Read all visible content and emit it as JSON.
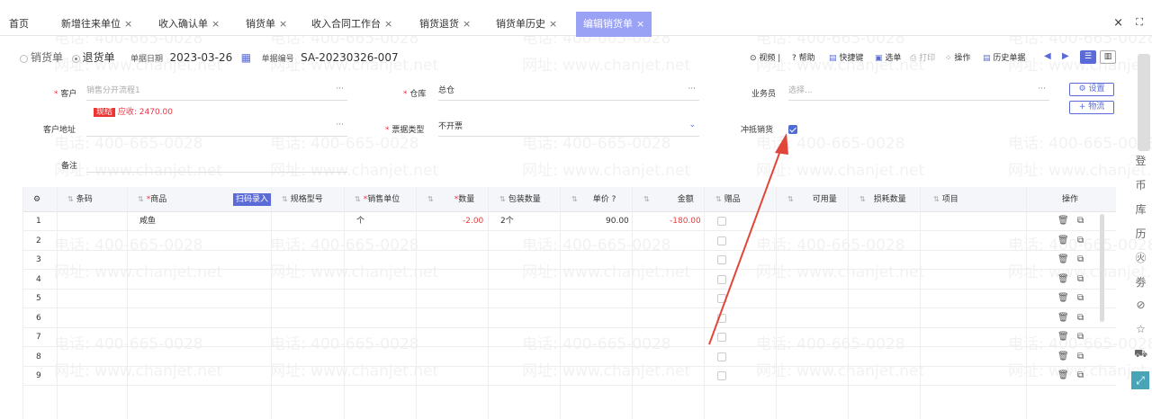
{
  "tabs": [
    {
      "label": "首页",
      "closable": false
    },
    {
      "label": "新增往来单位",
      "closable": true
    },
    {
      "label": "收入确认单",
      "closable": true
    },
    {
      "label": "销货单",
      "closable": true
    },
    {
      "label": "收入合同工作台",
      "closable": true
    },
    {
      "label": "销货退货",
      "closable": true
    },
    {
      "label": "销货单历史",
      "closable": true
    },
    {
      "label": "编辑销货单",
      "closable": true,
      "active": true
    }
  ],
  "tab_close": "×",
  "toolbar": {
    "doc_type_sale": "销货单",
    "doc_type_return": "退货单",
    "date_label": "单据日期",
    "date_value": "2023-03-26",
    "no_label": "单据编号",
    "no_value": "SA-20230326-007",
    "video": "视频",
    "help": "帮助",
    "shortcut": "快捷键",
    "select_doc": "选单",
    "print": "打印",
    "operate": "操作",
    "history": "历史单据"
  },
  "form": {
    "customer_label": "客户",
    "customer_placeholder": "销售分开流程1",
    "badge": "现结",
    "receivable": "应收: 2470.00",
    "warehouse_label": "仓库",
    "warehouse_value": "总仓",
    "salesman_label": "业务员",
    "salesman_placeholder": "选择...",
    "settings_btn": "设置",
    "logistics_btn": "物流",
    "address_label": "客户地址",
    "invoice_label": "票据类型",
    "invoice_value": "不开票",
    "offset_label": "冲抵销货",
    "offset_checked": true,
    "remark_label": "备注"
  },
  "grid": {
    "headers": [
      "条码",
      "商品",
      "规格型号",
      "销售单位",
      "数量",
      "包装数量",
      "单价",
      "金额",
      "赠品",
      "可用量",
      "损耗数量",
      "项目",
      "操作"
    ],
    "scan_btn": "扫码录入",
    "rows": [
      {
        "no": "1",
        "product": "咸鱼",
        "unit": "个",
        "qty": "-2.00",
        "pack": "2个",
        "price": "90.00",
        "amount": "-180.00"
      },
      {
        "no": "2"
      },
      {
        "no": "3"
      },
      {
        "no": "4"
      },
      {
        "no": "5"
      },
      {
        "no": "6"
      },
      {
        "no": "7"
      },
      {
        "no": "8"
      },
      {
        "no": "9"
      }
    ]
  },
  "sidebar_icons": [
    "ledger-icon",
    "money-icon",
    "warehouse-icon",
    "history-icon",
    "compare-icon",
    "coupon-icon",
    "link-icon",
    "star-icon",
    "truck-icon",
    "expand-icon"
  ],
  "sidebar_glyphs": [
    "登",
    "币",
    "库",
    "历",
    "㊋",
    "劵",
    "⊘",
    "☆",
    "⛟",
    "⤢"
  ],
  "watermark": {
    "phone": "电话: 400-665-0028",
    "site": "网址: www.chanjet.net"
  },
  "colors": {
    "accent": "#5a6bd8",
    "tab_active": "#9aa2f6",
    "arrow": "#e0473a",
    "negative": "#e34040"
  }
}
